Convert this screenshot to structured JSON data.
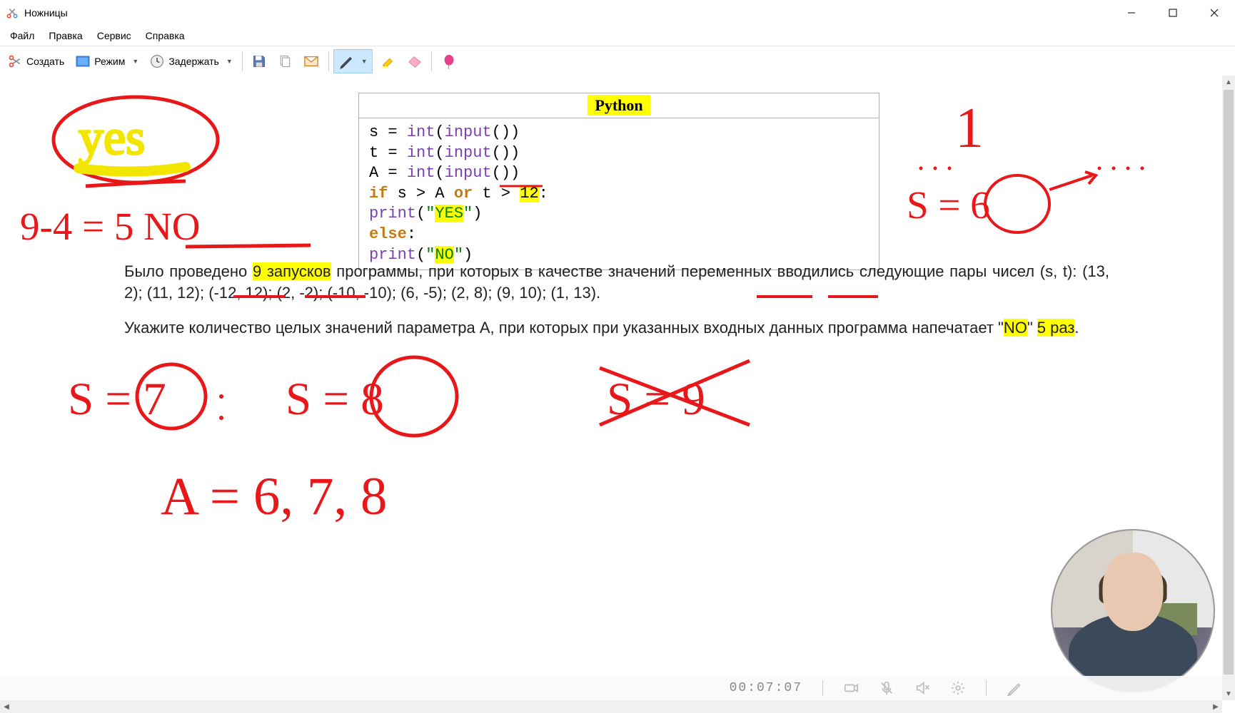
{
  "window": {
    "title": "Ножницы"
  },
  "menu": {
    "file": "Файл",
    "edit": "Правка",
    "service": "Сервис",
    "help": "Справка"
  },
  "toolbar": {
    "new": "Создать",
    "mode": "Режим",
    "delay": "Задержать"
  },
  "code": {
    "header": "Python",
    "l1a": "s = ",
    "l1b": "int",
    "l1c": "(",
    "l1d": "input",
    "l1e": "())",
    "l2a": "t = ",
    "l2b": "int",
    "l2c": "(",
    "l2d": "input",
    "l2e": "())",
    "l3a": "A = ",
    "l3b": "int",
    "l3c": "(",
    "l3d": "input",
    "l3e": "())",
    "l4a": "if",
    "l4b": " s > A ",
    "l4c": "or",
    "l4d": " t > ",
    "l4e": "12",
    "l4f": ":",
    "l5a": "    ",
    "l5b": "print",
    "l5c": "(",
    "l5d": "\"",
    "l5e": "YES",
    "l5f": "\"",
    "l5g": ")",
    "l6a": "else",
    "l6b": ":",
    "l7a": "    ",
    "l7b": "print",
    "l7c": "(",
    "l7d": "\"",
    "l7e": "NO",
    "l7f": "\"",
    "l7g": ")"
  },
  "problem": {
    "p1a": "Было проведено ",
    "p1b": "9 запусков",
    "p1c": " программы, при которых в качестве значений переменных вводились следующие пары чисел (s, t): (13, 2); (11, 12); (-12, 12); (2, -2); (-10, -10); (6, -5); (2, 8); (9, 10); (1, 13).",
    "p2a": "Укажите количество целых значений параметра A, при которых при указанных входных данных программа напечатает \"",
    "p2b": "NO",
    "p2c": "\" ",
    "p2d": "5 раз",
    "p2e": "."
  },
  "annotations": {
    "yes": "yes",
    "calc": "9-4 = 5 NO",
    "one": "1",
    "s6": "S = 6",
    "s7": "S = 7",
    "s8": "S = 8",
    "s9": "S = 9",
    "final": "A = 6, 7, 8"
  },
  "footer": {
    "timer": "00:07:07"
  }
}
